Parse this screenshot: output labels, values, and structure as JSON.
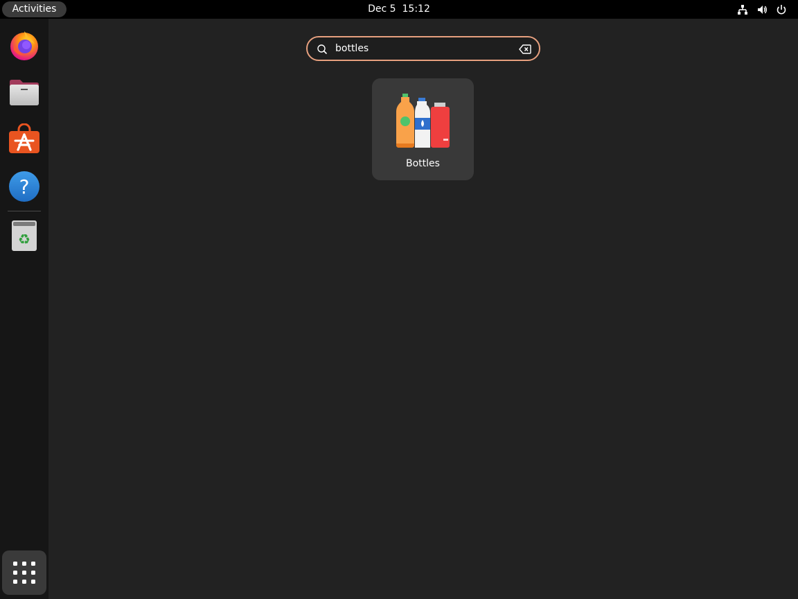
{
  "topbar": {
    "activities_label": "Activities",
    "date": "Dec 5",
    "time": "15:12",
    "tray_icons": [
      "network-icon",
      "volume-icon",
      "power-icon"
    ]
  },
  "dock": {
    "items": [
      {
        "name": "firefox",
        "icon": "firefox-icon"
      },
      {
        "name": "files",
        "icon": "files-icon"
      },
      {
        "name": "app-center",
        "icon": "app-center-icon"
      },
      {
        "name": "help",
        "icon": "help-icon"
      },
      {
        "name": "trash",
        "icon": "trash-icon"
      }
    ],
    "app_grid_icon": "app-grid-icon"
  },
  "search": {
    "value": "bottles",
    "icons": [
      "search-icon",
      "clear-icon"
    ]
  },
  "results": [
    {
      "label": "Bottles",
      "icon": "bottles-icon"
    }
  ],
  "colors": {
    "background": "#222222",
    "topbar": "#000000",
    "dock": "#161616",
    "search_border": "#e7a07f",
    "result_tile": "#393939"
  }
}
